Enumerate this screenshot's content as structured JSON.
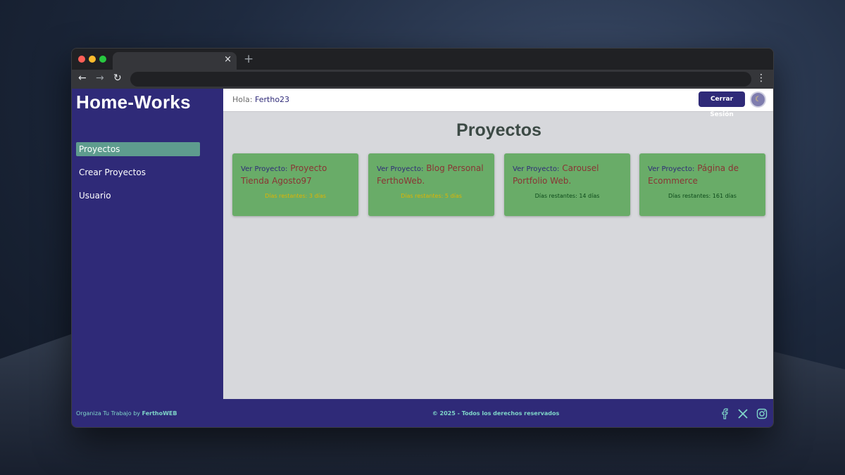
{
  "browser": {
    "tab_close": "×",
    "new_tab": "+",
    "back": "←",
    "forward": "→",
    "reload": "↻",
    "menu": "⋮"
  },
  "sidebar": {
    "brand": "Home-Works",
    "items": [
      {
        "label": "Proyectos",
        "active": true
      },
      {
        "label": "Crear Proyectos",
        "active": false
      },
      {
        "label": "Usuario",
        "active": false
      }
    ]
  },
  "header": {
    "greeting": "Hola:",
    "username": "Fertho23",
    "logout_label": "Cerrar Sesión",
    "theme_icon": "☾"
  },
  "main": {
    "title": "Proyectos",
    "card_prefix": "Ver Proyecto:",
    "cards": [
      {
        "name": "Proyecto Tienda Agosto97",
        "days": "Días restantes: 3 días",
        "days_color": "#e0b400"
      },
      {
        "name": "Blog Personal FerthoWeb.",
        "days": "Días restantes: 5 días",
        "days_color": "#e0b400"
      },
      {
        "name": "Carousel Portfolio Web.",
        "days": "Días restantes: 14 días",
        "days_color": "#0d4a1a"
      },
      {
        "name": "Página de Ecommerce",
        "days": "Días restantes: 161 días",
        "days_color": "#0d4a1a"
      }
    ]
  },
  "footer": {
    "left_text": "Organiza Tu Trabajo by",
    "left_brand": "FerthoWEB",
    "center": "© 2025 - Todos los derechos reservados",
    "socials": [
      "facebook-icon",
      "x-icon",
      "instagram-icon"
    ]
  },
  "colors": {
    "primary": "#2f2a78",
    "accent": "#5e9c8e",
    "card": "#69ac68",
    "footer_text": "#7fd6c9"
  }
}
